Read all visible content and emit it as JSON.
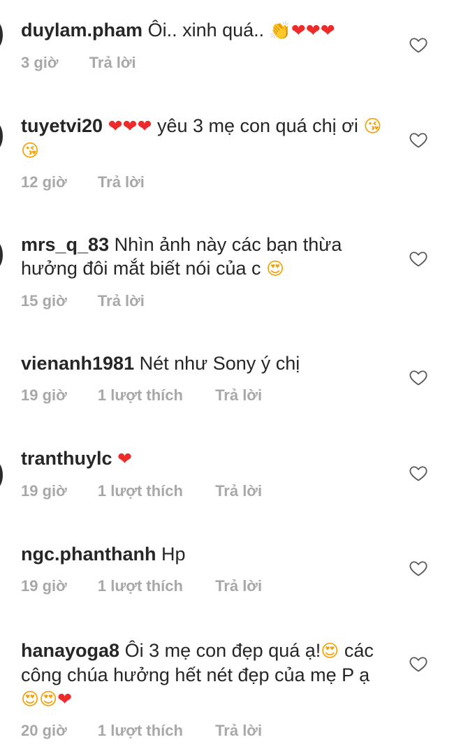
{
  "comments": [
    {
      "username": "duylam.pham",
      "text": "Ôi.. xinh quá..",
      "emoji": [
        "👏",
        "❤",
        "❤",
        "❤"
      ],
      "time": "3 giờ",
      "likes": "",
      "reply": "Trả lời"
    },
    {
      "username": "tuyetvi20",
      "text_pre_emoji": [
        "❤",
        "❤",
        "❤"
      ],
      "text": "yêu 3 mẹ con quá chị ơi",
      "emoji": [
        "😘",
        "😘"
      ],
      "time": "12 giờ",
      "likes": "",
      "reply": "Trả lời"
    },
    {
      "username": "mrs_q_83",
      "text": "Nhìn ảnh này các bạn thừa hưởng đôi mắt biết nói của c",
      "emoji": [
        "😍"
      ],
      "time": "15 giờ",
      "likes": "",
      "reply": "Trả lời"
    },
    {
      "username": "vienanh1981",
      "text": "Nét như Sony ý chị",
      "emoji": [],
      "time": "19 giờ",
      "likes": "1 lượt thích",
      "reply": "Trả lời"
    },
    {
      "username": "tranthuylc",
      "text": "",
      "emoji": [
        "❤"
      ],
      "time": "19 giờ",
      "likes": "1 lượt thích",
      "reply": "Trả lời"
    },
    {
      "username": "ngc.phanthanh",
      "text": "Hp",
      "emoji": [],
      "time": "19 giờ",
      "likes": "1 lượt thích",
      "reply": "Trả lời"
    },
    {
      "username": "hanayoga8",
      "text": "Ôi 3 mẹ con đẹp quá ạ!",
      "text_mid_emoji": [
        "😍"
      ],
      "text2": "các công chúa hưởng hết nét đẹp của mẹ P ạ",
      "emoji": [
        "😍",
        "😍",
        "❤"
      ],
      "time": "20 giờ",
      "likes": "1 lượt thích",
      "reply": "Trả lời"
    }
  ],
  "icons": {
    "like": "heart-outline-icon"
  },
  "colors": {
    "username": "#262626",
    "meta": "#a8a8a8",
    "heart_emoji": "#ed2b2b"
  }
}
